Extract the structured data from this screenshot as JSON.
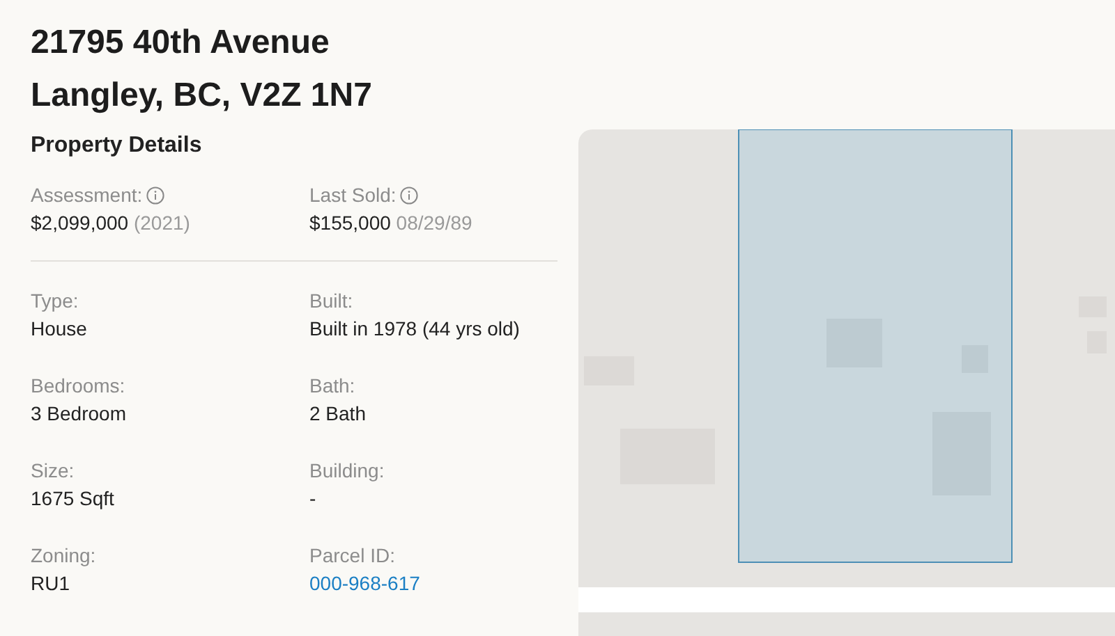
{
  "address": {
    "street": "21795 40th Avenue",
    "city": "Langley, BC, V2Z 1N7"
  },
  "section_title": "Property Details",
  "summary": [
    {
      "label": "Assessment:",
      "info": true,
      "value": "$2,099,000",
      "note": "(2021)"
    },
    {
      "label": "Last Sold:",
      "info": true,
      "value": "$155,000",
      "note": "08/29/89"
    }
  ],
  "details": [
    {
      "label": "Type:",
      "value": "House",
      "kind": "text"
    },
    {
      "label": "Built:",
      "value": "Built in 1978 (44 yrs old)",
      "kind": "text"
    },
    {
      "label": "Bedrooms:",
      "value": "3 Bedroom",
      "kind": "text"
    },
    {
      "label": "Bath:",
      "value": "2 Bath",
      "kind": "text"
    },
    {
      "label": "Size:",
      "value": "1675 Sqft",
      "kind": "text"
    },
    {
      "label": "Building:",
      "value": "-",
      "kind": "text"
    },
    {
      "label": "Zoning:",
      "value": "RU1",
      "kind": "text"
    },
    {
      "label": "Parcel ID:",
      "value": "000-968-617",
      "kind": "link"
    }
  ]
}
